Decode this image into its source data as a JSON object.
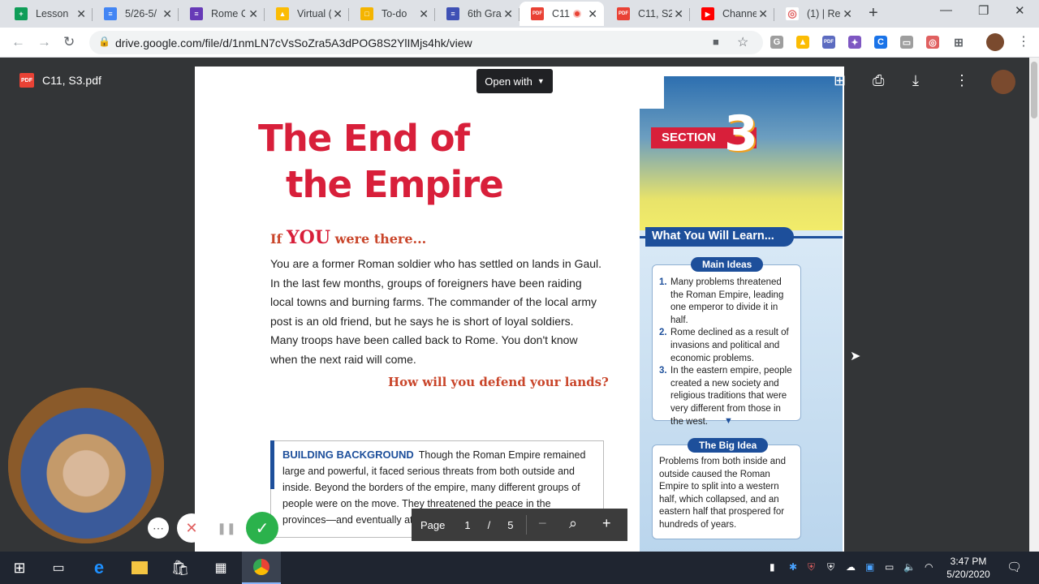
{
  "browser": {
    "tabs": [
      {
        "title": "Lesson",
        "fav_color": "#0f9d58",
        "fav_glyph": "+",
        "active": false
      },
      {
        "title": "5/26-5/",
        "fav_color": "#4285f4",
        "fav_glyph": "≡",
        "active": false
      },
      {
        "title": "Rome C",
        "fav_color": "#673ab7",
        "fav_glyph": "≡",
        "active": false
      },
      {
        "title": "Virtual (",
        "fav_color": "#fbbc04",
        "fav_glyph": "▲",
        "active": false
      },
      {
        "title": "To-do",
        "fav_color": "#f4b400",
        "fav_glyph": "□",
        "active": false
      },
      {
        "title": "6th Gra",
        "fav_color": "#3f51b5",
        "fav_glyph": "≡",
        "active": false
      },
      {
        "title": "C11",
        "fav_color": "#e94235",
        "fav_glyph": "PDF",
        "active": true
      },
      {
        "title": "C11, S2",
        "fav_color": "#e94235",
        "fav_glyph": "PDF",
        "active": false
      },
      {
        "title": "Channe",
        "fav_color": "#ff0000",
        "fav_glyph": "▶",
        "active": false
      },
      {
        "title": "(1) | Re",
        "fav_color": "#e06060",
        "fav_glyph": "◎",
        "active": false
      }
    ],
    "url": "drive.google.com/file/d/1nmLN7cVsSoZra5A3dPOG8S2YlIMjs4hk/view"
  },
  "viewer": {
    "file_name": "C11, S3.pdf",
    "open_with": "Open with",
    "page_label": "Page",
    "current_page": "1",
    "page_sep": "/",
    "total_pages": "5"
  },
  "document": {
    "title_line1": "The End of",
    "title_line2": "the Empire",
    "if_prefix": "If",
    "if_you": "YOU",
    "if_suffix": "were there...",
    "intro": "You are a former Roman soldier who has settled on lands in Gaul. In the last few months, groups of foreigners have been raiding local towns and burning farms. The commander of the local army post is an old friend, but he says he is short of loyal soldiers. Many troops have been called back to Rome. You don't know when the next raid will come.",
    "question": "How will you defend your lands?",
    "bg_head": "BUILDING BACKGROUND",
    "bg_text": "Though the Roman Empire remained large and powerful, it faced serious threats from both outside and inside. Beyond the borders of the empire, many different groups of people were on the move. They threatened the peace in the provinces—and eventually attacked the heart of the empire itself.",
    "section_label": "SECTION",
    "section_number": "3",
    "wywl": "What You Will Learn...",
    "main_ideas_label": "Main Ideas",
    "main_ideas": [
      {
        "n": "1.",
        "text": "Many problems threatened the Roman Empire, leading one emperor to divide it in half."
      },
      {
        "n": "2.",
        "text": "Rome declined as a result of invasions and political and economic problems."
      },
      {
        "n": "3.",
        "text": "In the eastern empire, people created a new society and religious traditions that were very different from those in the west."
      }
    ],
    "big_idea_label": "The Big Idea",
    "big_idea": "Problems from both inside and outside caused the Roman Empire to split into a western half, which collapsed, and an eastern half that prospered for hundreds of years."
  },
  "taskbar": {
    "time": "3:47 PM",
    "date": "5/20/2020"
  }
}
